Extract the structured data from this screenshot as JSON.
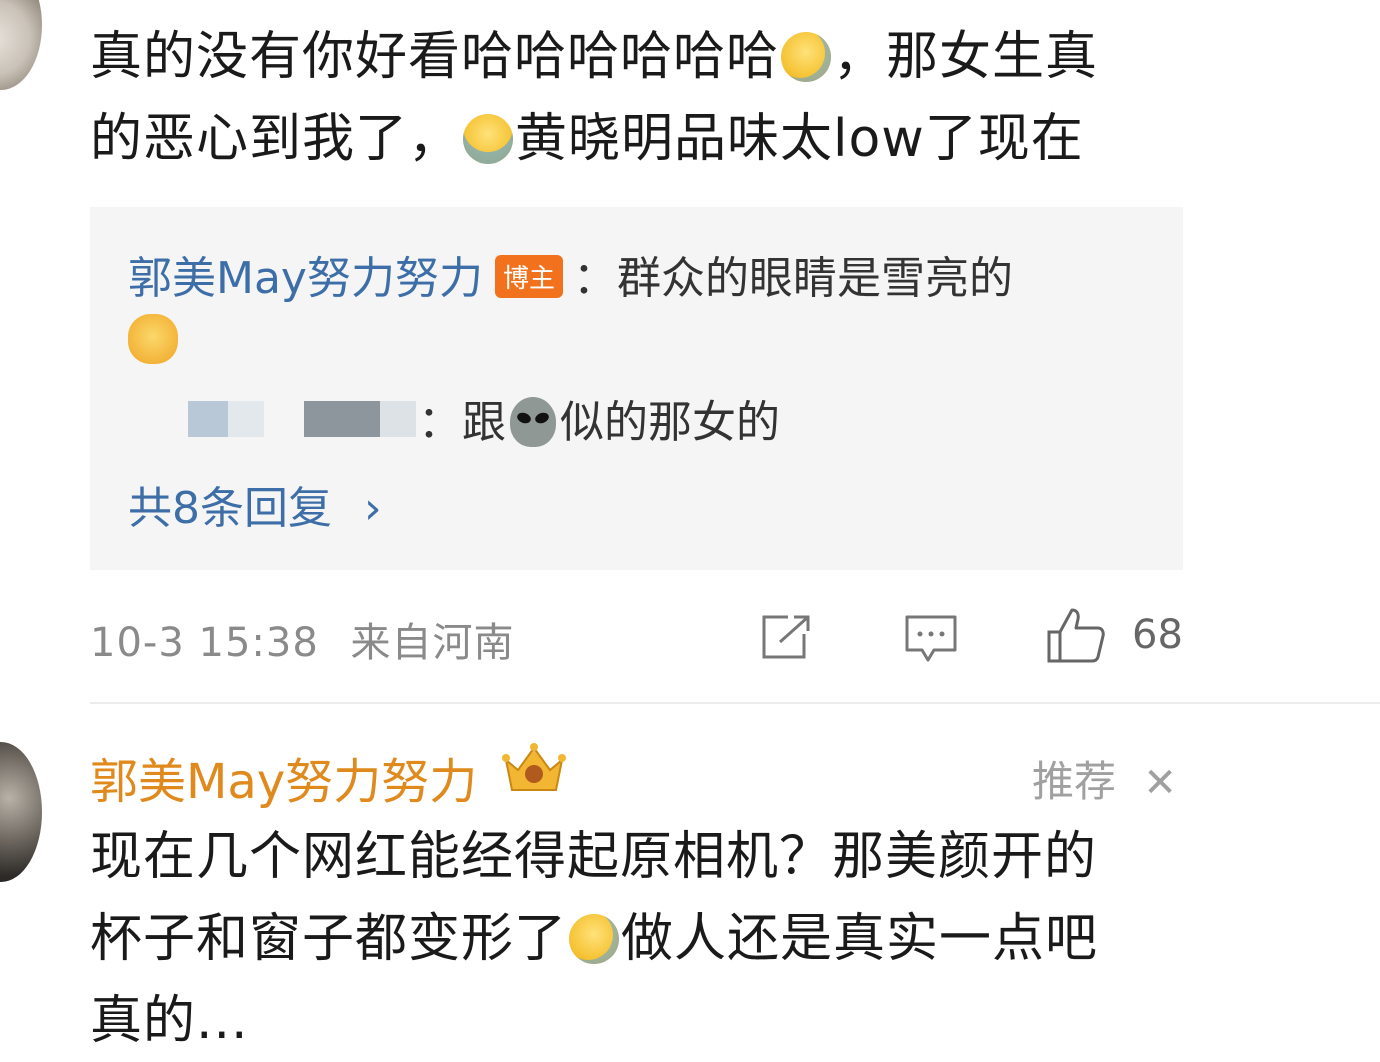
{
  "comment1": {
    "line1a": "真的没有你好看哈哈哈哈哈哈",
    "line1b": "，那女生真",
    "line2a": "的恶心到我了，",
    "line2b": "黄晓明品味太low了现在",
    "emojis": [
      "laugh-cry-emoji",
      "crying-emoji"
    ]
  },
  "replies": {
    "reply1": {
      "name": "郭美May努力努力",
      "badge": "博主",
      "sep": "：",
      "text": "群众的眼睛是雪亮的"
    },
    "reply2": {
      "sep": "：",
      "text_before": "跟",
      "text_after": "似的那女的"
    },
    "more": "共8条回复 ",
    "more_chevron": "›"
  },
  "meta": {
    "time": "10-3 15:38",
    "location": "来自河南",
    "like_count": "68"
  },
  "comment2": {
    "name": "郭美May努力努力",
    "recommend": "推荐",
    "close": "✕",
    "line1": "现在几个网红能经得起原相机？那美颜开的",
    "line2a": "杯子和窗子都变形了",
    "line2b": "做人还是真实一点吧",
    "line3": "真的..."
  },
  "colors": {
    "link_blue": "#3d6ea8",
    "name_orange": "#e08a1e",
    "badge_orange": "#f2711c",
    "meta_gray": "#8a8a8a"
  }
}
